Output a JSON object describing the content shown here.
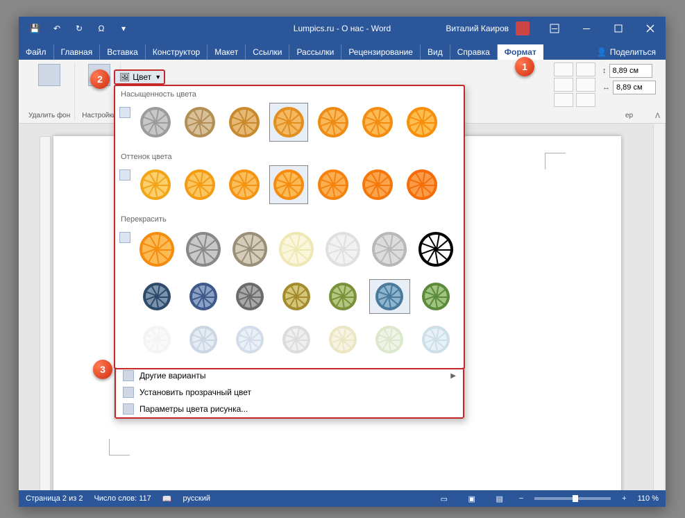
{
  "titlebar": {
    "title": "Lumpics.ru - О нас  -  Word",
    "user": "Виталий Каиров"
  },
  "tabs": {
    "items": [
      "Файл",
      "Главная",
      "Вставка",
      "Конструктор",
      "Макет",
      "Ссылки",
      "Рассылки",
      "Рецензирование",
      "Вид",
      "Справка",
      "Формат"
    ],
    "active_index": 10,
    "share": "Поделиться"
  },
  "ribbon": {
    "remove_bg": "Удалить фон",
    "corrections": "Настройки",
    "color_btn": "Цвет",
    "size_h": "8,89 см",
    "size_w": "8,89 см",
    "size_group_hint": "ер"
  },
  "panel": {
    "sat_title": "Насыщенность цвета",
    "tone_title": "Оттенок цвета",
    "recolor_title": "Перекрасить",
    "sat": [
      {
        "outer": "#9c9c9c",
        "inner": "#c7c7c7"
      },
      {
        "outer": "#b38f56",
        "inner": "#d8c09a"
      },
      {
        "outer": "#c98a2e",
        "inner": "#e6b873"
      },
      {
        "outer": "#e38f1f",
        "inner": "#f2b862"
      },
      {
        "outer": "#ef8a12",
        "inner": "#f8b85a"
      },
      {
        "outer": "#f58c10",
        "inner": "#fbba53"
      },
      {
        "outer": "#f98e0a",
        "inner": "#fcbd4e"
      }
    ],
    "sat_selected": 3,
    "tone": [
      {
        "outer": "#f2a519",
        "inner": "#fbcf6b"
      },
      {
        "outer": "#f49c14",
        "inner": "#fbc560"
      },
      {
        "outer": "#f59312",
        "inner": "#fbbe5c"
      },
      {
        "outer": "#f58c10",
        "inner": "#fbba53"
      },
      {
        "outer": "#f5820e",
        "inner": "#fbae4f"
      },
      {
        "outer": "#f5780c",
        "inner": "#fba44b"
      },
      {
        "outer": "#f56d0a",
        "inner": "#fb9a47"
      }
    ],
    "tone_selected": 3,
    "recolor": [
      [
        {
          "outer": "#f58c10",
          "inner": "#fbba53"
        },
        {
          "outer": "#888888",
          "inner": "#c8c8c8"
        },
        {
          "outer": "#9a8f78",
          "inner": "#d4ccb8"
        },
        {
          "outer": "#efe8b4",
          "inner": "#faf6dc"
        },
        {
          "outer": "#e0e0e0",
          "inner": "#f2f2f2"
        },
        {
          "outer": "#b8b8b8",
          "inner": "#dcdcdc"
        },
        {
          "outer": "#000000",
          "inner": "#ffffff"
        }
      ],
      [
        {
          "outer": "#2e4a6b",
          "inner": "#7a93ad"
        },
        {
          "outer": "#3f5a8a",
          "inner": "#8aa0c4"
        },
        {
          "outer": "#6b6b6b",
          "inner": "#a8a8a8"
        },
        {
          "outer": "#a38b2e",
          "inner": "#d4c678"
        },
        {
          "outer": "#7a913a",
          "inner": "#b4c67f"
        },
        {
          "outer": "#4a7a9c",
          "inner": "#8db4cc"
        },
        {
          "outer": "#5a8a3a",
          "inner": "#9ec47f"
        }
      ],
      [
        {
          "outer": "#f4f4f4",
          "inner": "#fafafa"
        },
        {
          "outer": "#cbd6e4",
          "inner": "#e6ecf3"
        },
        {
          "outer": "#d2dceb",
          "inner": "#ebf0f7"
        },
        {
          "outer": "#dcdcdc",
          "inner": "#efefef"
        },
        {
          "outer": "#ece6c4",
          "inner": "#f6f3e3"
        },
        {
          "outer": "#dce8cc",
          "inner": "#eef4e6"
        },
        {
          "outer": "#cde0ea",
          "inner": "#e8f1f6"
        }
      ]
    ],
    "recolor_selected": {
      "row": 1,
      "col": 5
    },
    "menu": {
      "more": "Другие варианты",
      "transparent": "Установить прозрачный цвет",
      "options": "Параметры цвета рисунка..."
    }
  },
  "status": {
    "page": "Страница 2 из 2",
    "words": "Число слов: 117",
    "lang": "русский",
    "zoom": "110 %"
  },
  "badges": [
    "1",
    "2",
    "3"
  ]
}
